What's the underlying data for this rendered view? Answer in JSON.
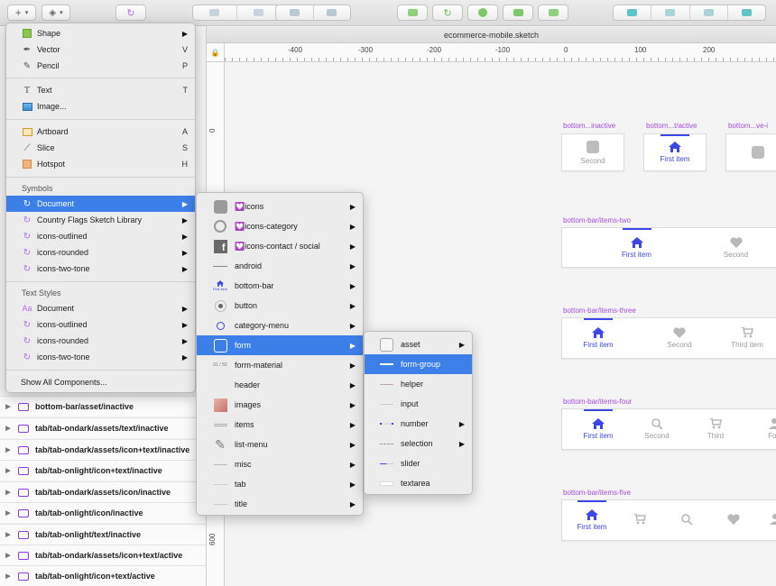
{
  "window": {
    "title": "ecommerce-mobile.sketch"
  },
  "ruler": {
    "horizontal_labels": [
      "-400",
      "-300",
      "-200",
      "-100",
      "0",
      "100",
      "200"
    ],
    "vertical_labels": [
      "0",
      "600"
    ]
  },
  "insert_menu": {
    "items": [
      {
        "label": "Shape",
        "shortcut": "",
        "icon": "shape-icon",
        "submenu": true
      },
      {
        "label": "Vector",
        "shortcut": "V",
        "icon": "pen-icon"
      },
      {
        "label": "Pencil",
        "shortcut": "P",
        "icon": "pencil-icon"
      },
      {
        "label": "Text",
        "shortcut": "T",
        "icon": "text-icon"
      },
      {
        "label": "Image...",
        "shortcut": "",
        "icon": "image-icon"
      },
      {
        "label": "Artboard",
        "shortcut": "A",
        "icon": "artboard-icon"
      },
      {
        "label": "Slice",
        "shortcut": "S",
        "icon": "slice-icon"
      },
      {
        "label": "Hotspot",
        "shortcut": "H",
        "icon": "hotspot-icon"
      }
    ],
    "symbols_header": "Symbols",
    "symbols": [
      {
        "label": "Document",
        "selected": true
      },
      {
        "label": "Country Flags Sketch Library"
      },
      {
        "label": "icons-outlined"
      },
      {
        "label": "icons-rounded"
      },
      {
        "label": "icons-two-tone"
      }
    ],
    "text_styles_header": "Text Styles",
    "text_styles": [
      {
        "label": "Document"
      },
      {
        "label": "icons-outlined"
      },
      {
        "label": "icons-rounded"
      },
      {
        "label": "icons-two-tone"
      }
    ],
    "show_all": "Show All Components..."
  },
  "document_submenu": {
    "items": [
      {
        "label": "💟icons"
      },
      {
        "label": "💟icons-category"
      },
      {
        "label": "💟icons-contact / social"
      },
      {
        "label": "android"
      },
      {
        "label": "bottom-bar"
      },
      {
        "label": "button"
      },
      {
        "label": "category-menu"
      },
      {
        "label": "form",
        "selected": true
      },
      {
        "label": "form-material"
      },
      {
        "label": "header"
      },
      {
        "label": "images"
      },
      {
        "label": "items"
      },
      {
        "label": "list-menu"
      },
      {
        "label": "misc"
      },
      {
        "label": "tab"
      },
      {
        "label": "title"
      }
    ],
    "thumb_texts": {
      "form_material": "01 / 50",
      "bottom_bar": "First item"
    }
  },
  "form_submenu": {
    "items": [
      {
        "label": "asset",
        "submenu": true
      },
      {
        "label": "form-group",
        "selected": true
      },
      {
        "label": "helper"
      },
      {
        "label": "input"
      },
      {
        "label": "number",
        "submenu": true
      },
      {
        "label": "selection",
        "submenu": true
      },
      {
        "label": "slider"
      },
      {
        "label": "textarea"
      }
    ]
  },
  "layers": [
    "bottom-bar/asset/inactive",
    "tab/tab-ondark/assets/text/inactive",
    "tab/tab-ondark/assets/icon+text/inactive",
    "tab/tab-onlight/icon+text/inactive",
    "tab/tab-ondark/assets/icon/inactive",
    "tab/tab-onlight/icon/inactive",
    "tab/tab-onlight/text/inactive",
    "tab/tab-ondark/assets/icon+text/active",
    "tab/tab-onlight/icon+text/active"
  ],
  "artboards": {
    "asset_inactive": {
      "label": "bottom...inactive",
      "item": "Second"
    },
    "asset_active": {
      "label": "bottom...t/active",
      "item": "First item"
    },
    "asset_ve": {
      "label": "bottom...ve-i"
    },
    "items_two": {
      "label": "bottom-bar/items-two",
      "items": [
        "First item",
        "Second"
      ]
    },
    "items_three": {
      "label": "bottom-bar/items-three",
      "items": [
        "First item",
        "Second",
        "Third item"
      ]
    },
    "items_four": {
      "label": "bottom-bar/items-four",
      "items": [
        "First item",
        "Second",
        "Third",
        "Fou"
      ]
    },
    "items_five": {
      "label": "bottom-bar/items-five",
      "items": [
        "First item"
      ]
    }
  },
  "colors": {
    "accent": "#3d7fe8",
    "brand_blue": "#3b47e6",
    "symbol_purple": "#a64de0",
    "inactive": "#9a9a9a"
  }
}
